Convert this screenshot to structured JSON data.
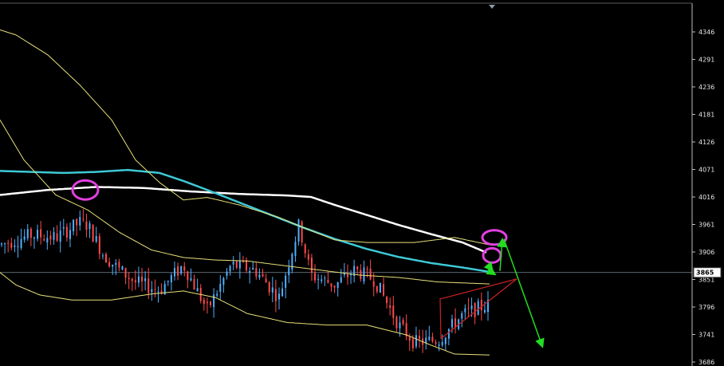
{
  "chart_data": {
    "type": "candlestick",
    "title": "",
    "xlabel": "",
    "ylabel": "",
    "ylim": [
      3680,
      4380
    ],
    "y_ticks": [
      "4346",
      "4291",
      "4236",
      "4181",
      "4126",
      "4071",
      "4016",
      "3961",
      "3906",
      "3851",
      "3796",
      "3741",
      "3686"
    ],
    "current_price": {
      "label": "3865",
      "value": 3865,
      "box_color": "#ffffff",
      "line_color": "#7a8a99"
    },
    "colors": {
      "background": "#000000",
      "candle_up": "#4fb0ff",
      "candle_down": "#ff4a4a",
      "cyan_ma": "#3ec9d6",
      "white_ma": "#ffffff",
      "yellow_band": "#e8e27a",
      "circle": "#e040e0",
      "arrow": "#22dd22",
      "triangle": "#cc2222",
      "axis": "#bdbdbd"
    },
    "series": [
      {
        "key": "white_ma",
        "x": [
          0,
          60,
          120,
          180,
          240,
          300,
          360,
          390,
          420,
          460,
          500,
          540,
          580,
          610
        ],
        "y": [
          4020,
          4030,
          4036,
          4034,
          4027,
          4022,
          4019,
          4016,
          4000,
          3980,
          3960,
          3942,
          3925,
          3905
        ]
      },
      {
        "key": "cyan_ma",
        "x": [
          0,
          40,
          80,
          120,
          160,
          200,
          230,
          260,
          300,
          340,
          380,
          420,
          460,
          500,
          540,
          580,
          615
        ],
        "y": [
          4068,
          4066,
          4064,
          4066,
          4070,
          4064,
          4048,
          4030,
          4005,
          3980,
          3955,
          3932,
          3912,
          3896,
          3884,
          3875,
          3866
        ]
      },
      {
        "key": "yellow_upper",
        "x": [
          0,
          20,
          60,
          100,
          140,
          170,
          200,
          230,
          260,
          300,
          350,
          380,
          420,
          460,
          520,
          570,
          615
        ],
        "y": [
          4350,
          4340,
          4300,
          4240,
          4170,
          4090,
          4045,
          4010,
          4015,
          4000,
          3975,
          3955,
          3930,
          3925,
          3925,
          3935,
          3920
        ]
      },
      {
        "key": "yellow_upper2",
        "x": [
          0,
          30,
          70,
          110,
          150,
          190,
          230,
          270,
          310,
          350,
          400,
          450,
          500,
          550,
          615
        ],
        "y": [
          4170,
          4090,
          4020,
          3990,
          3945,
          3910,
          3895,
          3890,
          3888,
          3880,
          3870,
          3860,
          3855,
          3846,
          3842
        ]
      },
      {
        "key": "yellow_lower",
        "x": [
          0,
          20,
          50,
          90,
          140,
          190,
          230,
          270,
          310,
          360,
          410,
          460,
          510,
          540,
          570,
          615
        ],
        "y": [
          3865,
          3840,
          3820,
          3810,
          3810,
          3822,
          3828,
          3815,
          3783,
          3765,
          3760,
          3760,
          3740,
          3720,
          3702,
          3700
        ]
      }
    ],
    "candles_seed": 7,
    "candles_count": 150,
    "candles_path": {
      "x": [
        0,
        40,
        70,
        100,
        110,
        130,
        150,
        170,
        200,
        230,
        260,
        290,
        320,
        350,
        375,
        390,
        420,
        445,
        470,
        500,
        520,
        550,
        580,
        610
      ],
      "y": [
        3920,
        3940,
        3935,
        3965,
        3960,
        3900,
        3870,
        3845,
        3830,
        3880,
        3790,
        3880,
        3870,
        3815,
        3960,
        3860,
        3840,
        3870,
        3850,
        3760,
        3725,
        3730,
        3780,
        3800
      ]
    },
    "annotations": {
      "circles": [
        {
          "x": 107,
          "y": 4030
        },
        {
          "x": 620,
          "y": 3935
        },
        {
          "x": 617,
          "y": 3899
        }
      ],
      "arrows": [
        {
          "from": [
            632,
            3932
          ],
          "to": [
            680,
            3718
          ]
        },
        {
          "from": [
            612,
            3870
          ],
          "to": [
            620,
            3862
          ]
        },
        {
          "from": [
            627,
            3868
          ],
          "to": [
            630,
            3930
          ]
        },
        {
          "from": [
            612,
            3880
          ],
          "to": [
            617,
            3870
          ]
        }
      ],
      "triangle": [
        [
          552,
          3812
        ],
        [
          648,
          3852
        ],
        [
          553,
          3733
        ]
      ]
    },
    "top_marker": {
      "x": 617
    }
  }
}
